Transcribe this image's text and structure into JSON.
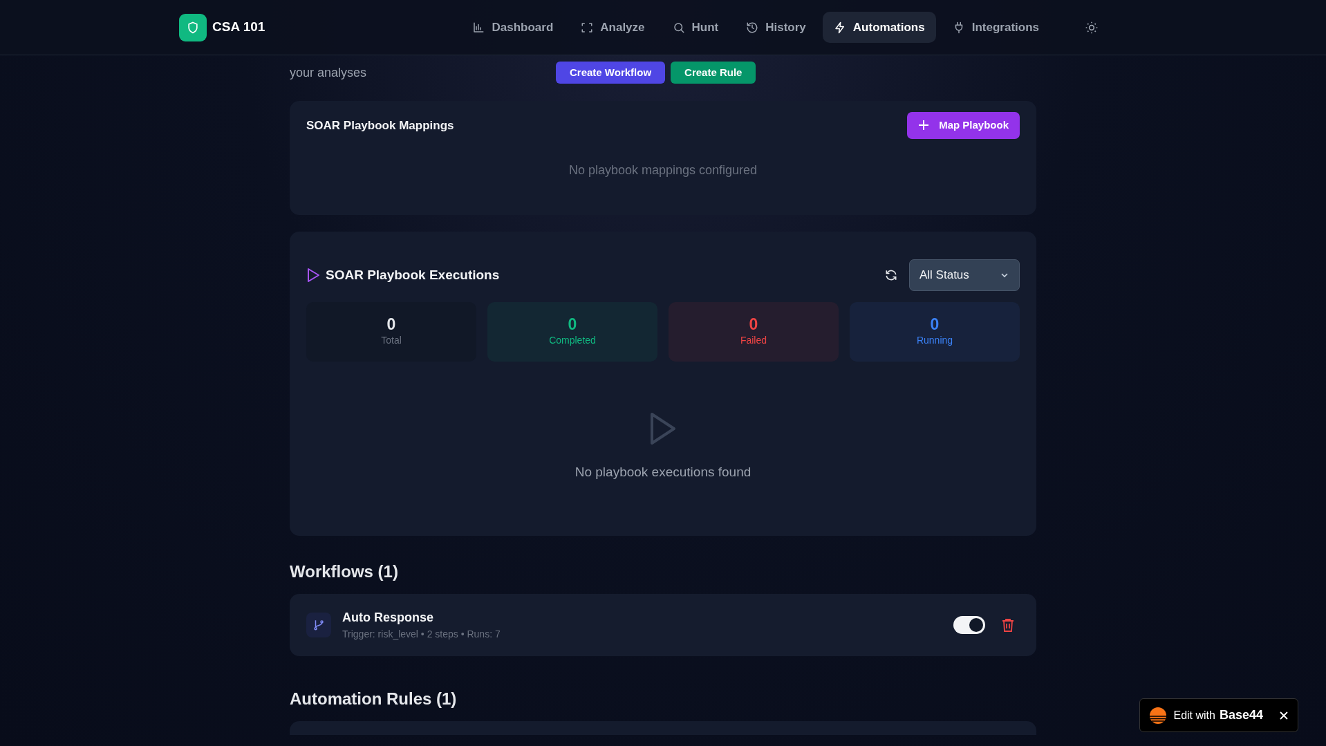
{
  "brand": {
    "name": "CSA 101"
  },
  "nav": [
    {
      "label": "Dashboard",
      "selected": false
    },
    {
      "label": "Analyze",
      "selected": false
    },
    {
      "label": "Hunt",
      "selected": false
    },
    {
      "label": "History",
      "selected": false
    },
    {
      "label": "Automations",
      "selected": true
    },
    {
      "label": "Integrations",
      "selected": false
    }
  ],
  "subheader": {
    "text": "your analyses",
    "buttons": [
      {
        "label": "Create Workflow",
        "kind": "primary"
      },
      {
        "label": "Create Rule",
        "kind": "success"
      }
    ]
  },
  "mappings": {
    "title": "SOAR Playbook Mappings",
    "button": "Map Playbook",
    "empty": "No playbook mappings configured"
  },
  "executions": {
    "title": "SOAR Playbook Executions",
    "filter": "All Status",
    "stats": [
      {
        "value": "0",
        "label": "Total",
        "color": "#e5e7eb"
      },
      {
        "value": "0",
        "label": "Completed",
        "color": "#10b981"
      },
      {
        "value": "0",
        "label": "Failed",
        "color": "#ef4444"
      },
      {
        "value": "0",
        "label": "Running",
        "color": "#3b82f6"
      }
    ],
    "empty": "No playbook executions found"
  },
  "workflows": {
    "heading": "Workflows (1)",
    "items": [
      {
        "name": "Auto Response",
        "meta": "Trigger: risk_level • 2 steps • Runs: 7",
        "on": true
      }
    ]
  },
  "rules": {
    "heading": "Automation Rules (1)"
  },
  "badge": {
    "text": "Edit with",
    "brand": "Base44"
  }
}
